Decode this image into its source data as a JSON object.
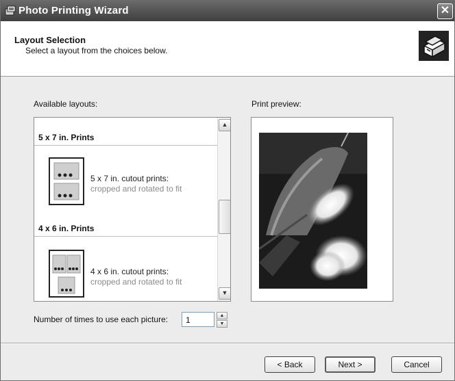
{
  "window": {
    "title": "Photo Printing Wizard"
  },
  "header": {
    "title": "Layout Selection",
    "subtitle": "Select a layout from the choices below."
  },
  "layouts": {
    "label": "Available layouts:",
    "groups": [
      {
        "title": "5 x 7 in. Prints",
        "item": {
          "title": "5 x 7 in. cutout prints:",
          "desc": "cropped and rotated to fit"
        }
      },
      {
        "title": "4 x 6 in. Prints",
        "item": {
          "title": "4 x 6 in. cutout prints:",
          "desc": "cropped and rotated to fit"
        }
      }
    ]
  },
  "preview": {
    "label": "Print preview:"
  },
  "copies": {
    "label": "Number of times to use each picture:",
    "value": "1"
  },
  "buttons": {
    "back": "< Back",
    "next": "Next >",
    "cancel": "Cancel"
  },
  "icons": {
    "title": "wizard-window-icon",
    "header": "printer-photos-icon",
    "close": "close-icon"
  }
}
